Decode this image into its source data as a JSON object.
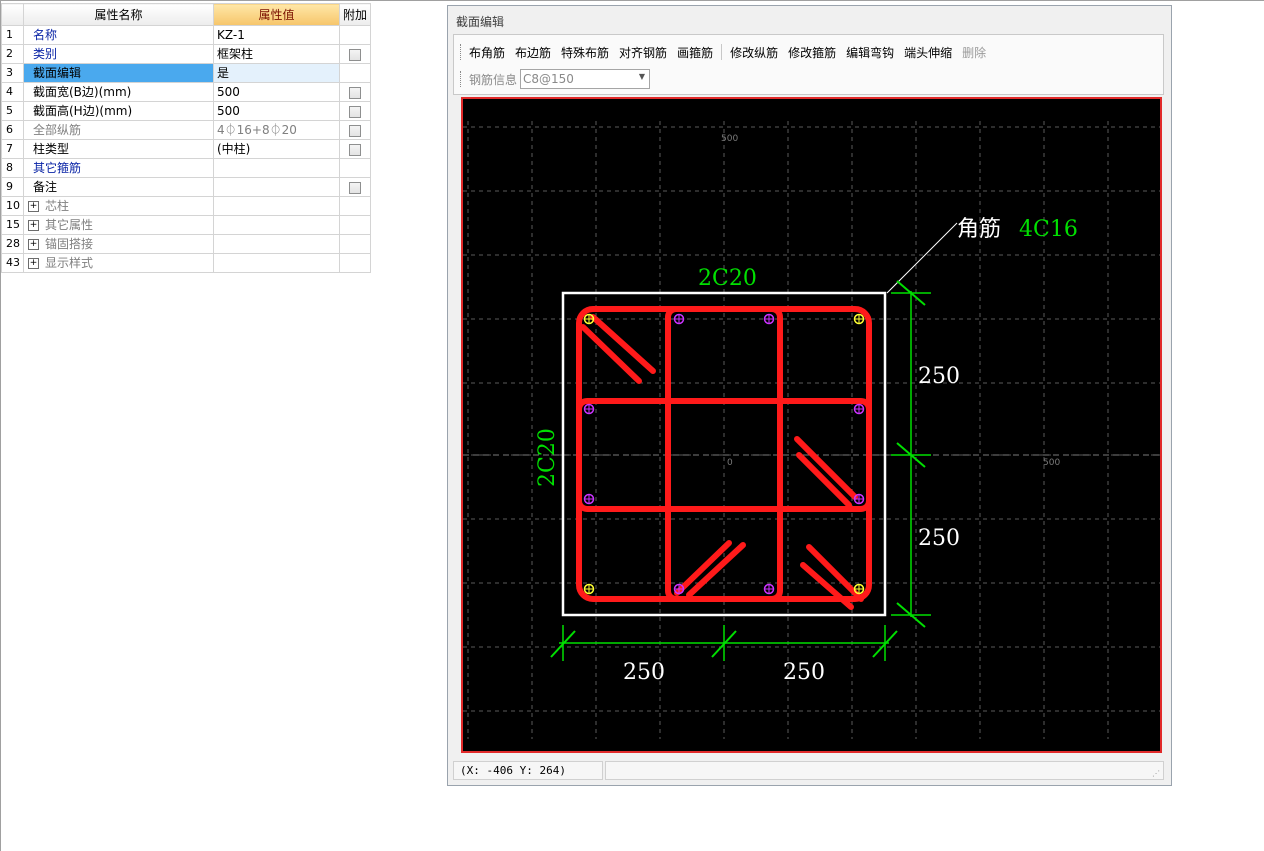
{
  "grid": {
    "headers": {
      "name": "属性名称",
      "value": "属性值",
      "extra": "附加"
    },
    "rows": [
      {
        "no": "1",
        "name": "名称",
        "value": "KZ-1",
        "style": "blue",
        "checkbox": false
      },
      {
        "no": "2",
        "name": "类别",
        "value": "框架柱",
        "style": "blue",
        "checkbox": true
      },
      {
        "no": "3",
        "name": "截面编辑",
        "value": "是",
        "style": "blue",
        "checkbox": false,
        "selected": true
      },
      {
        "no": "4",
        "name": "截面宽(B边)(mm)",
        "value": "500",
        "style": "black",
        "checkbox": true
      },
      {
        "no": "5",
        "name": "截面高(H边)(mm)",
        "value": "500",
        "style": "black",
        "checkbox": true
      },
      {
        "no": "6",
        "name": "全部纵筋",
        "value": "4⏀16+8⏀20",
        "style": "gray",
        "checkbox": true
      },
      {
        "no": "7",
        "name": "柱类型",
        "value": "(中柱)",
        "style": "black",
        "checkbox": true
      },
      {
        "no": "8",
        "name": "其它箍筋",
        "value": "",
        "style": "blue",
        "checkbox": false
      },
      {
        "no": "9",
        "name": "备注",
        "value": "",
        "style": "black",
        "checkbox": true
      },
      {
        "no": "10",
        "name": "芯柱",
        "value": "",
        "style": "gray",
        "checkbox": false,
        "expand": true
      },
      {
        "no": "15",
        "name": "其它属性",
        "value": "",
        "style": "gray",
        "checkbox": false,
        "expand": true
      },
      {
        "no": "28",
        "name": "锚固搭接",
        "value": "",
        "style": "gray",
        "checkbox": false,
        "expand": true
      },
      {
        "no": "43",
        "name": "显示样式",
        "value": "",
        "style": "gray",
        "checkbox": false,
        "expand": true
      }
    ]
  },
  "window": {
    "title": "截面编辑",
    "toolbar": {
      "buttons": [
        "布角筋",
        "布边筋",
        "特殊布筋",
        "对齐钢筋",
        "画箍筋"
      ],
      "buttons2": [
        "修改纵筋",
        "修改箍筋",
        "编辑弯钩",
        "端头伸缩"
      ],
      "delete_label": "删除",
      "rebar_info_label": "钢筋信息",
      "rebar_info_value": "C8@150"
    },
    "status": {
      "coords": "(X: -406 Y: 264)"
    }
  },
  "drawing": {
    "colors": {
      "stirrup": "#ff1a1a",
      "dimension": "#00e000",
      "outline": "#ffffff",
      "grid": "#5a5a5a",
      "corner_bar": "#ffff33",
      "side_bar": "#cc33ff"
    },
    "corner_label": "角筋",
    "corner_spec": "4C16",
    "top_side_spec": "2C20",
    "left_side_spec": "2C20",
    "dims_right": [
      "250",
      "250"
    ],
    "dims_bottom": [
      "250",
      "250"
    ],
    "axis_labels": {
      "top": "500",
      "center": "0",
      "right": "500"
    }
  }
}
